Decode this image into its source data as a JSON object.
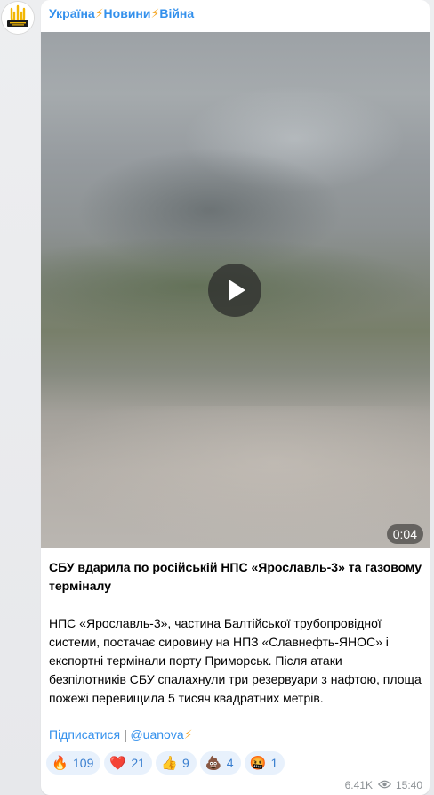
{
  "channel": {
    "title_parts": [
      "Україна",
      "⚡",
      "Новини",
      "⚡",
      "Війна"
    ],
    "avatar_icon": "trident-logo-icon"
  },
  "video": {
    "duration": "0:04",
    "play_icon": "play-icon"
  },
  "post": {
    "title": "СБУ вдарила по російській НПС «Ярославль-3» та газовому терміналу",
    "body": "НПС «Ярославль-3», частина Балтійської трубопровідної системи, постачає сировину на НПЗ «Славнефть-ЯНОС» і експортні термінали порту Приморськ. Після атаки безпілотників СБУ спалахнули три резервуари з нафтою, площа пожежі перевищила 5 тисяч квадратних метрів.",
    "subscribe_link": "Підписатися",
    "separator": "|",
    "handle_link": "@uanova",
    "handle_bolt": "⚡"
  },
  "reactions": [
    {
      "emoji": "🔥",
      "icon": "fire-icon",
      "count": "109"
    },
    {
      "emoji": "❤️",
      "icon": "heart-icon",
      "count": "21"
    },
    {
      "emoji": "👍",
      "icon": "thumbs-up-icon",
      "count": "9"
    },
    {
      "emoji": "💩",
      "icon": "poop-icon",
      "count": "4"
    },
    {
      "emoji": "🤬",
      "icon": "angry-face-icon",
      "count": "1"
    }
  ],
  "meta": {
    "views": "6.41K",
    "time": "15:40",
    "views_icon": "eye-icon"
  },
  "colors": {
    "link": "#3390ec",
    "accent_bolt": "#f5a623",
    "reaction_bg": "#e8f1fc",
    "meta_text": "#8d9296"
  }
}
